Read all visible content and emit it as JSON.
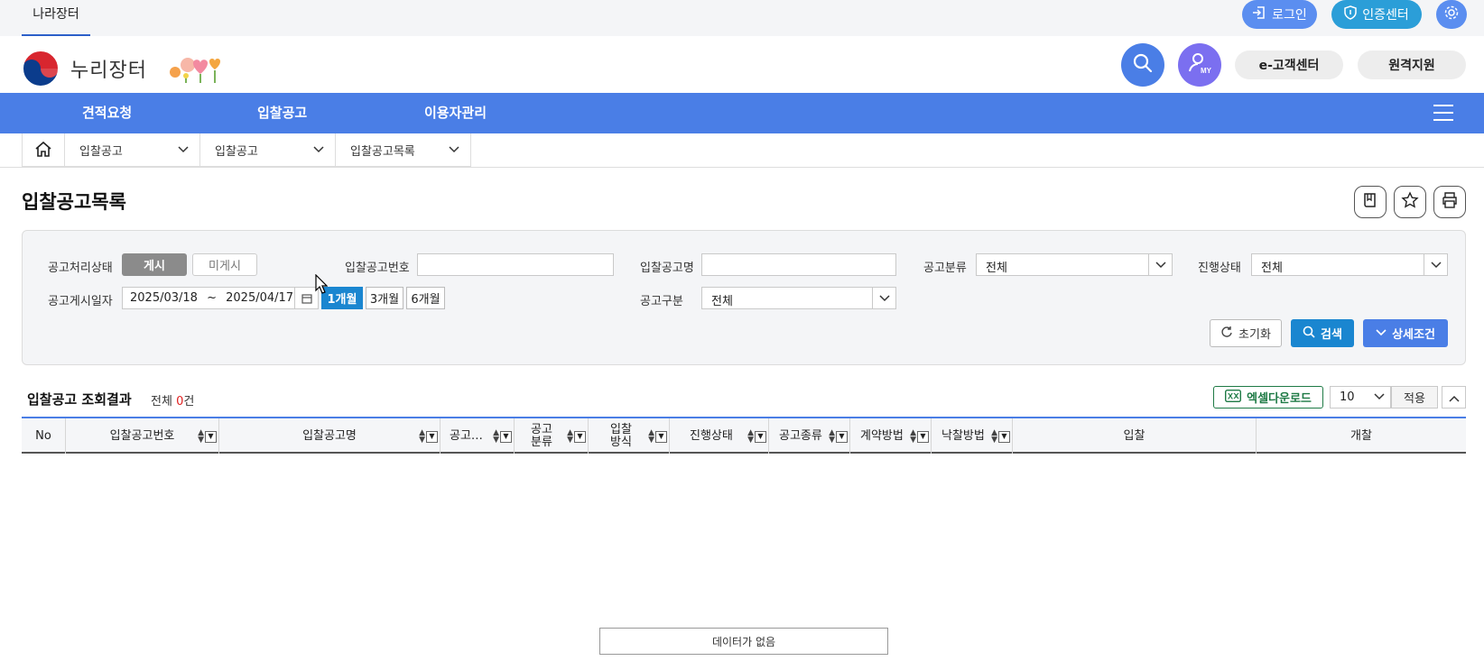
{
  "topbar": {
    "site_tab": "나라장터",
    "login": "로그인",
    "cert_center": "인증센터"
  },
  "header": {
    "logo_text": "누리장터",
    "cs_center": "e-고객센터",
    "remote_support": "원격지원"
  },
  "gnb": {
    "items": [
      "견적요청",
      "입찰공고",
      "이용자관리"
    ]
  },
  "breadcrumb": {
    "items": [
      "입찰공고",
      "입찰공고",
      "입찰공고목록"
    ]
  },
  "page": {
    "title": "입찰공고목록"
  },
  "search": {
    "status_label": "공고처리상태",
    "status_on": "게시",
    "status_off": "미게시",
    "notice_no_label": "입찰공고번호",
    "notice_no_value": "",
    "notice_name_label": "입찰공고명",
    "notice_name_value": "",
    "category_label": "공고분류",
    "category_value": "전체",
    "progress_label": "진행상태",
    "progress_value": "전체",
    "date_label": "공고게시일자",
    "date_from": "2025/03/18",
    "date_sep": "~",
    "date_to": "2025/04/17",
    "month1": "1개월",
    "month3": "3개월",
    "month6": "6개월",
    "type_label": "공고구분",
    "type_value": "전체",
    "reset": "초기화",
    "find": "검색",
    "detail": "상세조건"
  },
  "result": {
    "title": "입찰공고 조회결과",
    "count_prefix": "전체 ",
    "count": "0",
    "count_suffix": "건",
    "excel": "엑셀다운로드",
    "page_size": "10",
    "apply": "적용",
    "empty_text": "데이터가 없음"
  },
  "grid": {
    "columns": [
      "No",
      "입찰공고번호",
      "입찰공고명",
      "공고…",
      "공고\n분류",
      "입찰\n방식",
      "진행상태",
      "공고종류",
      "계약방법",
      "낙찰방법",
      "입찰",
      "개찰"
    ]
  },
  "colors": {
    "primary": "#4a7ee6",
    "search_blue": "#1a86d0",
    "excel_green": "#1e7a45",
    "count_red": "#e02020"
  }
}
